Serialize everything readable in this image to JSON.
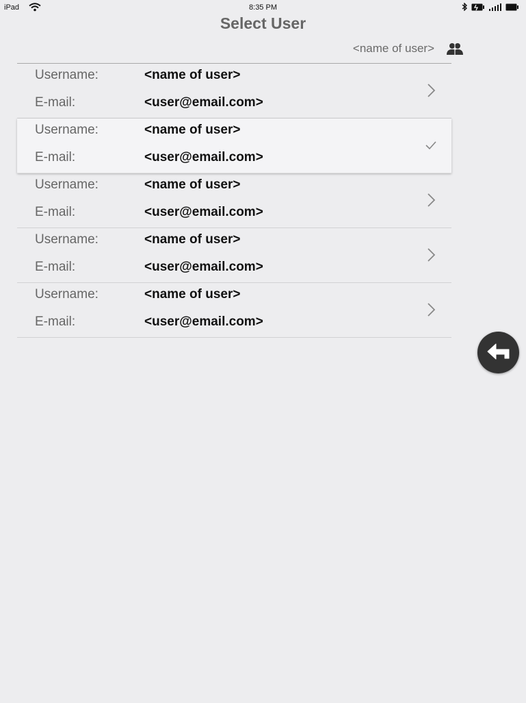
{
  "status_bar": {
    "device": "iPad",
    "time": "8:35 PM"
  },
  "header": {
    "title": "Select User",
    "current_user": "<name of user>",
    "users_icon": "users-icon"
  },
  "users": [
    {
      "username_label": "Username:",
      "username": "<name of user>",
      "email_label": "E-mail:",
      "email": "<user@email.com>",
      "selected": false
    },
    {
      "username_label": "Username:",
      "username": "<name of user>",
      "email_label": "E-mail:",
      "email": "<user@email.com>",
      "selected": true
    },
    {
      "username_label": "Username:",
      "username": "<name of user>",
      "email_label": "E-mail:",
      "email": "<user@email.com>",
      "selected": false
    },
    {
      "username_label": "Username:",
      "username": "<name of user>",
      "email_label": "E-mail:",
      "email": "<user@email.com>",
      "selected": false
    },
    {
      "username_label": "Username:",
      "username": "<name of user>",
      "email_label": "E-mail:",
      "email": "<user@email.com>",
      "selected": false
    }
  ],
  "actions": {
    "back_icon": "return-arrow-icon"
  },
  "colors": {
    "background": "#ededef",
    "selected_row": "#f4f4f6",
    "back_button": "#333333"
  }
}
